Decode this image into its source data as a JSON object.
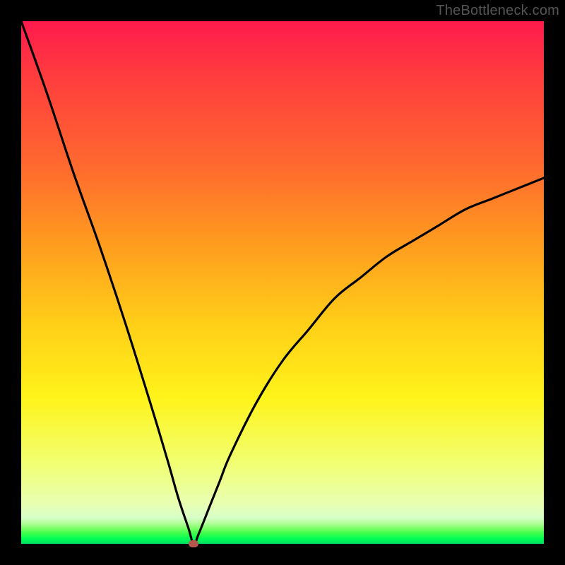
{
  "watermark": {
    "text": "TheBottleneck.com"
  },
  "colors": {
    "frame_bg": "#000000",
    "curve_stroke": "#000000",
    "marker_fill": "#b5564f"
  },
  "chart_data": {
    "type": "line",
    "title": "",
    "xlabel": "",
    "ylabel": "",
    "xlim": [
      0,
      100
    ],
    "ylim": [
      0,
      100
    ],
    "note": "V-shaped bottleneck curve. y≈0 at the marker (balanced point); rises steeply toward 100 on the left edge and asymptotically toward ~70 on the right edge. Background gradient encodes severity: green (low y) → red (high y).",
    "series": [
      {
        "name": "bottleneck-curve",
        "x": [
          0,
          5,
          10,
          15,
          20,
          25,
          28,
          30,
          32,
          33,
          34,
          36,
          38,
          40,
          45,
          50,
          55,
          60,
          65,
          70,
          75,
          80,
          85,
          90,
          95,
          100
        ],
        "y": [
          100,
          86,
          71,
          57,
          42,
          26,
          16,
          9,
          3,
          0,
          2,
          7,
          12,
          17,
          27,
          35,
          41,
          47,
          51,
          55,
          58,
          61,
          64,
          66,
          68,
          70
        ]
      }
    ],
    "annotations": [
      {
        "name": "balanced-marker",
        "x": 33,
        "y": 0,
        "color": "#b5564f"
      }
    ],
    "gradient_stops": [
      {
        "pos": 0,
        "color": "#ff1a4d"
      },
      {
        "pos": 28,
        "color": "#ff6a2e"
      },
      {
        "pos": 58,
        "color": "#ffcf18"
      },
      {
        "pos": 84,
        "color": "#f2ff6e"
      },
      {
        "pos": 97,
        "color": "#7dff68"
      },
      {
        "pos": 100,
        "color": "#00e060"
      }
    ]
  }
}
